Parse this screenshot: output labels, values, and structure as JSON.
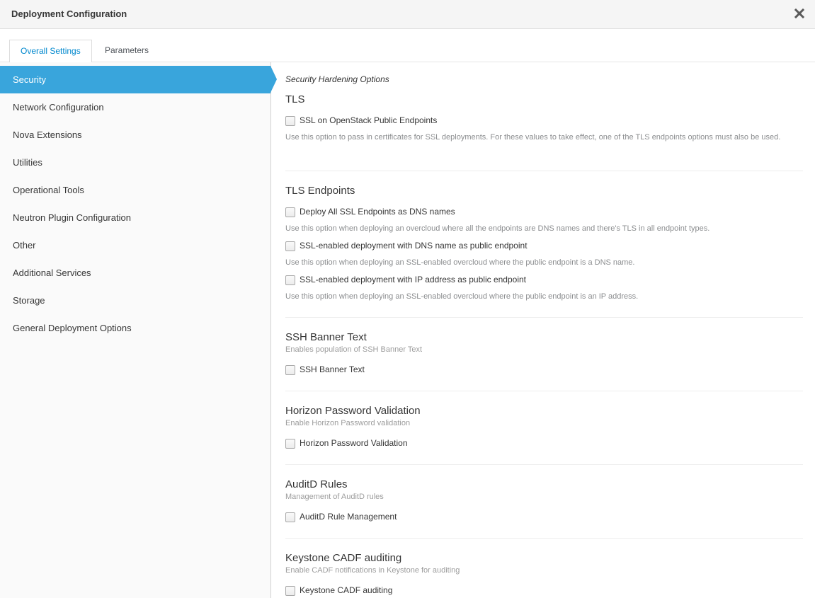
{
  "header": {
    "title": "Deployment Configuration",
    "close_icon": "close-icon"
  },
  "tabs": [
    {
      "label": "Overall Settings",
      "active": true
    },
    {
      "label": "Parameters",
      "active": false
    }
  ],
  "sidebar": {
    "items": [
      {
        "label": "Security",
        "active": true
      },
      {
        "label": "Network Configuration"
      },
      {
        "label": "Nova Extensions"
      },
      {
        "label": "Utilities"
      },
      {
        "label": "Operational Tools"
      },
      {
        "label": "Neutron Plugin Configuration"
      },
      {
        "label": "Other"
      },
      {
        "label": "Additional Services"
      },
      {
        "label": "Storage"
      },
      {
        "label": "General Deployment Options"
      }
    ]
  },
  "content": {
    "subtitle": "Security Hardening Options",
    "sections": [
      {
        "title": "TLS",
        "options": [
          {
            "label": "SSL on OpenStack Public Endpoints",
            "checked": false,
            "help": "Use this option to pass in certificates for SSL deployments. For these values to take effect, one of the TLS endpoints options must also be used."
          }
        ]
      },
      {
        "title": "TLS Endpoints",
        "options": [
          {
            "label": "Deploy All SSL Endpoints as DNS names",
            "checked": false,
            "help": "Use this option when deploying an overcloud where all the endpoints are DNS names and there's TLS in all endpoint types."
          },
          {
            "label": "SSL-enabled deployment with DNS name as public endpoint",
            "checked": false,
            "help": "Use this option when deploying an SSL-enabled overcloud where the public endpoint is a DNS name."
          },
          {
            "label": "SSL-enabled deployment with IP address as public endpoint",
            "checked": false,
            "help": "Use this option when deploying an SSL-enabled overcloud where the public endpoint is an IP address."
          }
        ]
      },
      {
        "title": "SSH Banner Text",
        "description": "Enables population of SSH Banner Text",
        "options": [
          {
            "label": "SSH Banner Text",
            "checked": false
          }
        ]
      },
      {
        "title": "Horizon Password Validation",
        "description": "Enable Horizon Password validation",
        "options": [
          {
            "label": "Horizon Password Validation",
            "checked": false
          }
        ]
      },
      {
        "title": "AuditD Rules",
        "description": "Management of AuditD rules",
        "options": [
          {
            "label": "AuditD Rule Management",
            "checked": false
          }
        ]
      },
      {
        "title": "Keystone CADF auditing",
        "description": "Enable CADF notifications in Keystone for auditing",
        "options": [
          {
            "label": "Keystone CADF auditing",
            "checked": false
          }
        ]
      }
    ]
  }
}
